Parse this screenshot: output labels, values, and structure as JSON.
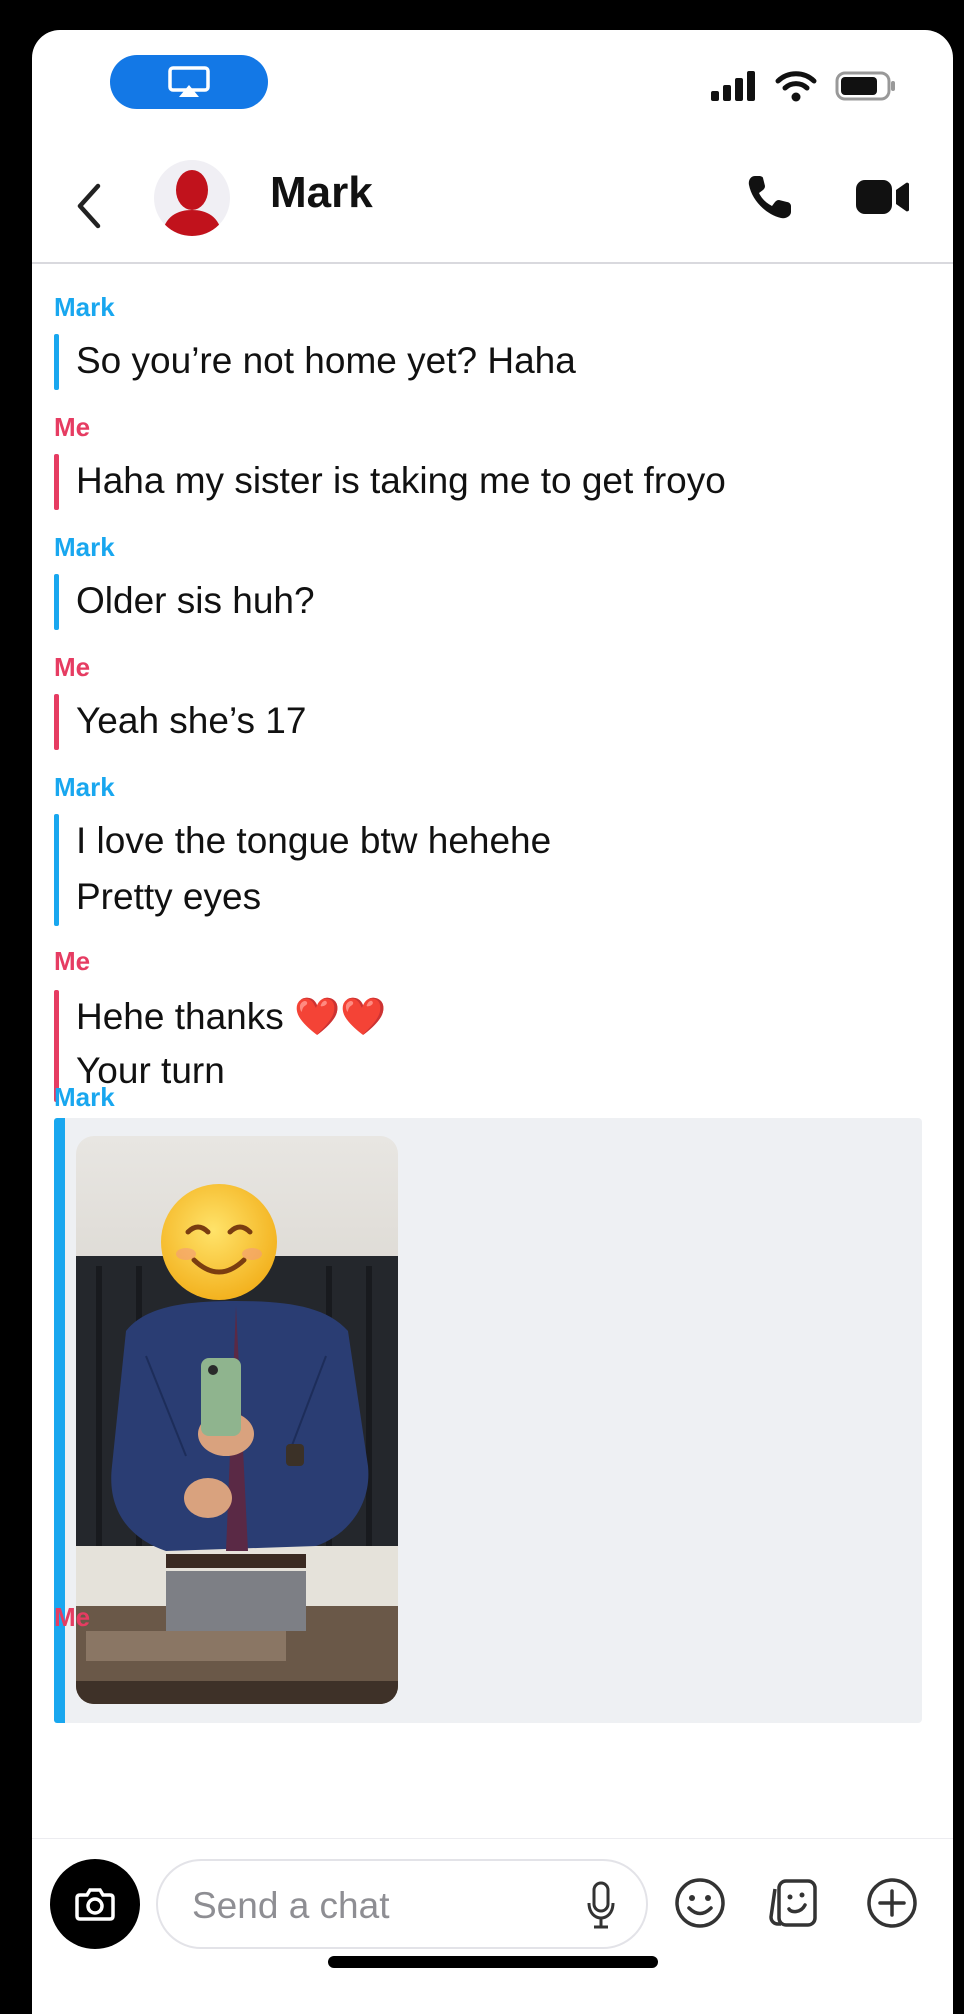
{
  "header": {
    "contact_name": "Mark"
  },
  "messages": [
    {
      "sender": "Mark",
      "lines": [
        "So you’re not home yet? Haha"
      ]
    },
    {
      "sender": "Me",
      "lines": [
        "Haha my sister is taking me to get froyo"
      ]
    },
    {
      "sender": "Mark",
      "lines": [
        "Older sis huh?"
      ]
    },
    {
      "sender": "Me",
      "lines": [
        "Yeah she’s 17"
      ]
    },
    {
      "sender": "Mark",
      "lines": [
        "I love the tongue btw hehehe",
        "Pretty eyes"
      ]
    },
    {
      "sender": "Me",
      "lines": [
        "Hehe thanks ❤️❤️",
        "Your turn"
      ]
    },
    {
      "sender": "Mark",
      "media": "photo"
    },
    {
      "sender": "Me",
      "lines": []
    }
  ],
  "composer": {
    "placeholder": "Send a chat"
  },
  "colors": {
    "them": "#19a7ef",
    "me": "#e63c62",
    "airplay": "#1378e6"
  },
  "icons": [
    "airplay-icon",
    "cellular-signal-icon",
    "wifi-icon",
    "battery-icon",
    "back-chevron-icon",
    "phone-icon",
    "video-camera-icon",
    "camera-icon",
    "microphone-icon",
    "smiley-icon",
    "sticker-icon",
    "plus-circle-icon"
  ]
}
